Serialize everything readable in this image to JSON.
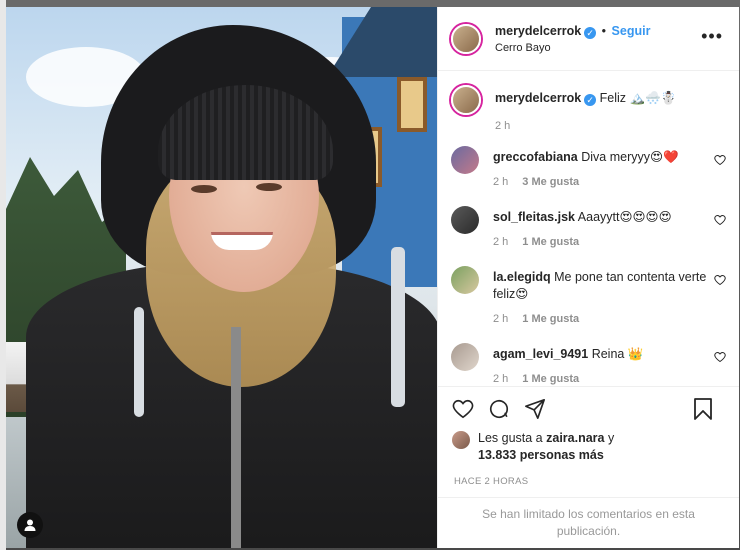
{
  "post": {
    "username": "merydelcerrok",
    "follow_label": "Seguir",
    "separator": "•",
    "location": "Cerro Bayo",
    "more_label": "•••"
  },
  "caption": {
    "username": "merydelcerrok",
    "text": "Feliz 🏔️🌨️☃️",
    "time": "2 h"
  },
  "comments": [
    {
      "username": "greccofabiana",
      "text": "Diva meryyy😍❤️",
      "time": "2 h",
      "likes": "3 Me gusta"
    },
    {
      "username": "sol_fleitas.jsk",
      "text": "Aaayytt😍😍😍😍",
      "time": "2 h",
      "likes": "1 Me gusta"
    },
    {
      "username": "la.elegidq",
      "text": "Me pone tan contenta verte feliz😍",
      "time": "2 h",
      "likes": "1 Me gusta"
    },
    {
      "username": "agam_levi_9491",
      "text": "Reina 👑",
      "time": "2 h",
      "likes": "1 Me gusta"
    }
  ],
  "likes": {
    "prefix": "Les gusta a",
    "user": "zaira.nara",
    "joiner": "y",
    "count": "13.833 personas más"
  },
  "time_ago": "HACE 2 HORAS",
  "comments_limited": "Se han limitado los comentarios en esta publicación.",
  "colors": {
    "accent": "#3897f0",
    "text": "#262626",
    "muted": "#8e8e8e",
    "border": "#efefef"
  }
}
